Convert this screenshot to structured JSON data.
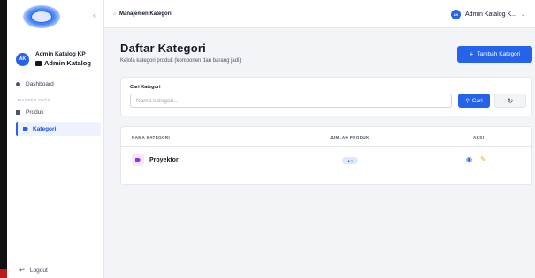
{
  "sidebar": {
    "collapse_icon": "chevron-left-icon",
    "user": {
      "initials": "AK",
      "name": "Admin Katalog KP",
      "role": "Admin Katalog"
    },
    "nav": {
      "dashboard": "Dashboard",
      "section_master": "MASTER DATA",
      "produk": "Produk",
      "kategori": "Kategori"
    },
    "logout": "Logout"
  },
  "topbar": {
    "breadcrumb": "Manajemen Kategori",
    "user_initials": "AK",
    "user_name": "Admin Katalog K..."
  },
  "page": {
    "title": "Daftar Kategori",
    "subtitle": "Kelola kategori produk (komponen dan barang jadi)",
    "add_button": "Tambah Kategori"
  },
  "search": {
    "label": "Cari Kategori",
    "placeholder": "Nama kategori...",
    "button": "Cari",
    "reset_icon": "reset-icon"
  },
  "table": {
    "columns": [
      "NAMA KATEGORI",
      "JUMLAH PRODUK",
      "AKSI"
    ],
    "rows": [
      {
        "name": "Proyektor",
        "count": "1"
      }
    ]
  },
  "colors": {
    "primary": "#2563eb",
    "active_bg": "#eef2ff",
    "edit": "#eab308",
    "category_icon": "#9333ea"
  }
}
